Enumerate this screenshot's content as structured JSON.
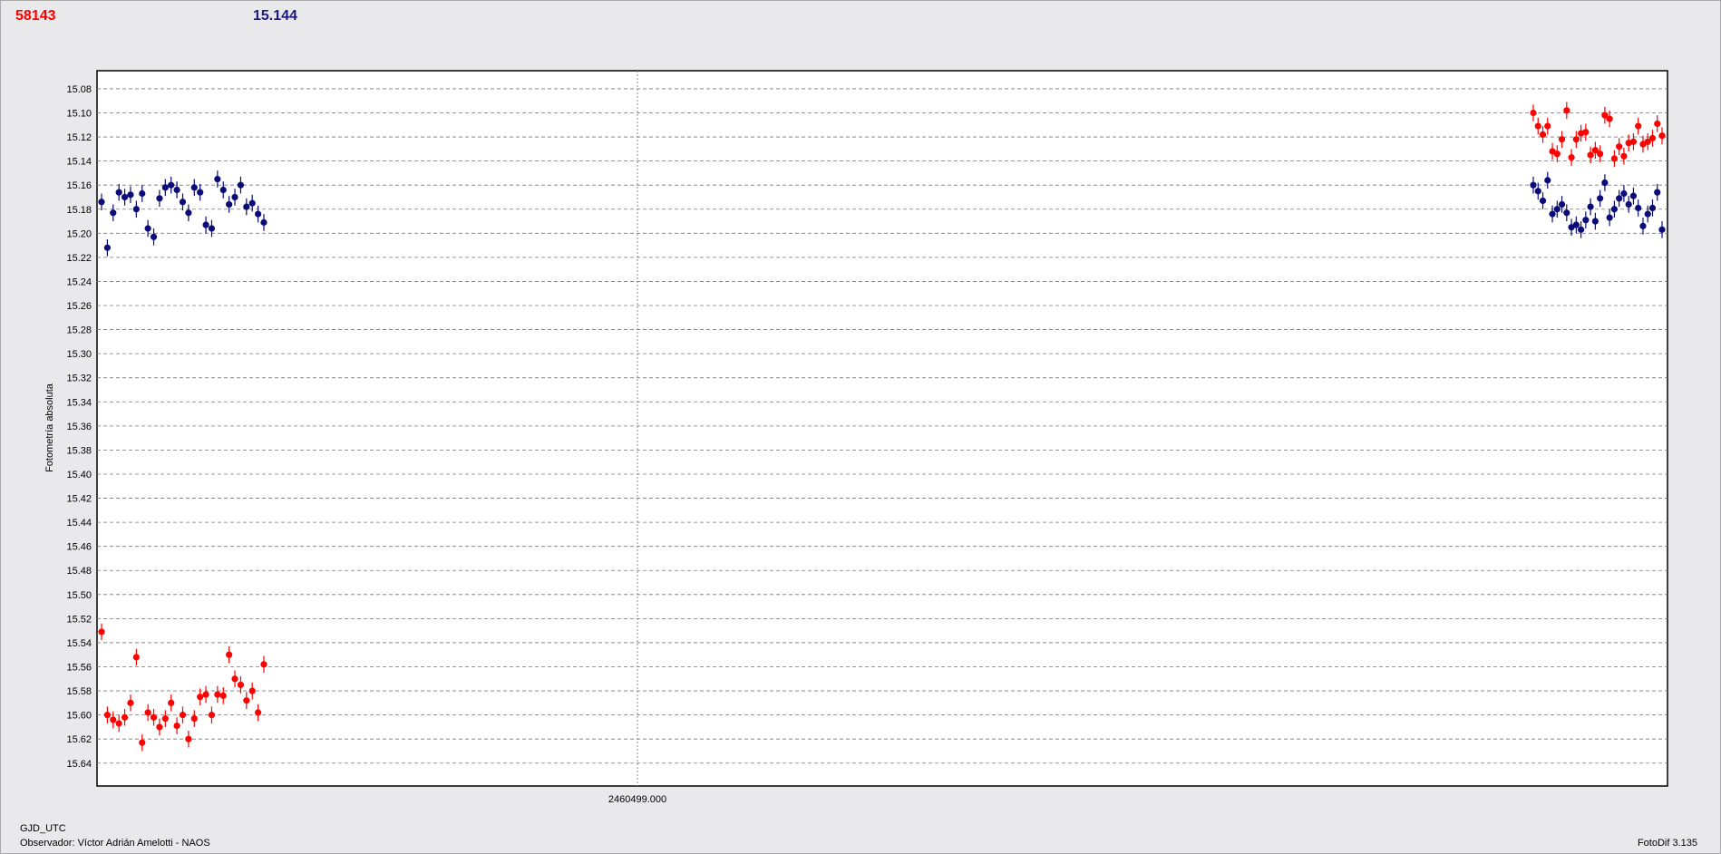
{
  "header": {
    "left_value": "58143",
    "left_color": "#ff0000",
    "right_value": "15.144",
    "right_color": "#1a1a80"
  },
  "footer": {
    "x_axis_name": "GJD_UTC",
    "observer": "Observador: Víctor Adrián Amelotti - NAOS",
    "version": "FotoDif 3.135"
  },
  "chart_data": {
    "type": "scatter",
    "ylabel": "Fotometría absoluta",
    "y_inverted": true,
    "ylim": [
      15.065,
      15.659
    ],
    "yticks": [
      "15.08",
      "15.10",
      "15.12",
      "15.14",
      "15.16",
      "15.18",
      "15.20",
      "15.22",
      "15.24",
      "15.26",
      "15.28",
      "15.30",
      "15.32",
      "15.34",
      "15.36",
      "15.38",
      "15.40",
      "15.42",
      "15.44",
      "15.46",
      "15.48",
      "15.50",
      "15.52",
      "15.54",
      "15.56",
      "15.58",
      "15.60",
      "15.62",
      "15.64"
    ],
    "xtick_label": "2460499.000",
    "grid": true,
    "error_bar": 0.007,
    "series": [
      {
        "color": "#0a0a78",
        "segments": [
          [
            15.174,
            15.212,
            15.183,
            15.166,
            15.17,
            15.168,
            15.18,
            15.167,
            15.196,
            15.203,
            15.171,
            15.162,
            15.16,
            15.164,
            15.174,
            15.183,
            15.162,
            15.166,
            15.193,
            15.196,
            15.155,
            15.164,
            15.176,
            15.17,
            15.16,
            15.178,
            15.175,
            15.184,
            15.191
          ],
          [
            15.16,
            15.165,
            15.173,
            15.156,
            15.184,
            15.18,
            15.176,
            15.183,
            15.195,
            15.193,
            15.197,
            15.189,
            15.178,
            15.19,
            15.171,
            15.158,
            15.187,
            15.18,
            15.171,
            15.167,
            15.176,
            15.169,
            15.179,
            15.194,
            15.184,
            15.179,
            15.166,
            15.197
          ]
        ]
      },
      {
        "color": "#ff0000",
        "segments": [
          [
            15.531,
            15.6,
            15.604,
            15.607,
            15.602,
            15.59,
            15.552,
            15.623,
            15.598,
            15.602,
            15.61,
            15.603,
            15.59,
            15.609,
            15.6,
            15.62,
            15.603,
            15.585,
            15.583,
            15.6,
            15.583,
            15.584,
            15.55,
            15.57,
            15.575,
            15.588,
            15.58,
            15.598,
            15.558
          ],
          [
            15.1,
            15.111,
            15.118,
            15.111,
            15.132,
            15.134,
            15.122,
            15.098,
            15.137,
            15.122,
            15.117,
            15.116,
            15.135,
            15.131,
            15.134,
            15.102,
            15.105,
            15.138,
            15.128,
            15.136,
            15.125,
            15.124,
            15.111,
            15.126,
            15.124,
            15.121,
            15.109,
            15.119
          ]
        ]
      }
    ]
  }
}
